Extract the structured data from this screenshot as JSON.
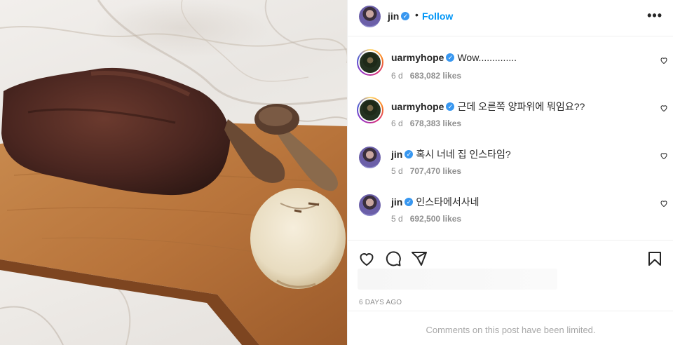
{
  "post": {
    "author": "jin",
    "verified_icon": "verified-badge-icon",
    "separator": "•",
    "follow_label": "Follow",
    "more_label": "•••",
    "date": "6 DAYS AGO",
    "comments_limited": "Comments on this post have been limited."
  },
  "comments": [
    {
      "user": "uarmyhope",
      "text": "Wow..............",
      "time": "6 d",
      "likes": "683,082 likes"
    },
    {
      "user": "uarmyhope",
      "text": "근데 오른쪽 양파위에 뭐임요??",
      "time": "6 d",
      "likes": "678,383 likes"
    },
    {
      "user": "jin",
      "text": "혹시 너네 집 인스타임?",
      "time": "5 d",
      "likes": "707,470 likes"
    },
    {
      "user": "jin",
      "text": "인스타에서사네",
      "time": "5 d",
      "likes": "692,500 likes"
    }
  ],
  "actions": {
    "like_icon": "heart-icon",
    "comment_icon": "comment-icon",
    "share_icon": "share-icon",
    "save_icon": "bookmark-icon"
  },
  "colors": {
    "accent": "#0095f6",
    "verified": "#3897f0",
    "meta_text": "#8e8e8e"
  }
}
